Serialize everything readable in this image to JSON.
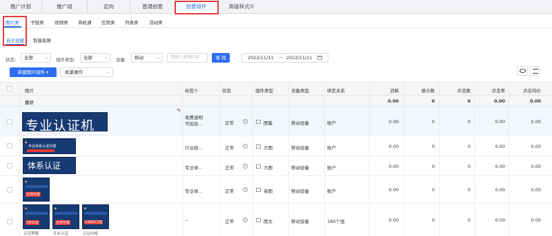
{
  "top_tabs": [
    "推广计划",
    "推广组",
    "定向",
    "普通创意",
    "创意组件",
    "高级样式⑦"
  ],
  "sub_tabs": [
    "图片类",
    "子链类",
    "视频类",
    "商机通",
    "应用类",
    "列表类",
    "活动类"
  ],
  "mode_tabs": [
    "自主创建",
    "智能拓展"
  ],
  "filters": {
    "status_label": "状态:",
    "status_value": "全部",
    "type_label": "组件类型:",
    "type_value": "全部",
    "device_label": "设备:",
    "device_value": "移动",
    "search_placeholder": "请输入查询内容",
    "search_button": "查 找",
    "date_start": "2022/11/11",
    "date_arrow": "→",
    "date_end": "2022/11/11"
  },
  "actions": {
    "new_button": "新建图片组件 ▾",
    "batch_select": "批量操作"
  },
  "table": {
    "headers": [
      "图片",
      "标签⑦",
      "状态",
      "组件类型",
      "设备类型",
      "绑定关系",
      "消耗",
      "展示数",
      "点击数",
      "点击率",
      "点击均价"
    ],
    "total_label": "总计",
    "total_values": [
      "0.00",
      "0",
      "0",
      "0.00",
      "0.00"
    ],
    "rows": [
      {
        "thumb_text": "专业认证机构",
        "label": "收费透明\n可加急...",
        "status": "正常",
        "type": "图集",
        "device": "移动设备",
        "binding": "账户",
        "metrics": [
          "0.00",
          "0",
          "0",
          "0.00",
          "0.00"
        ]
      },
      {
        "thumb_text": "专业体系认证办理",
        "label": "行业经...",
        "status": "正常",
        "type": "大图",
        "device": "移动设备",
        "binding": "账户",
        "metrics": [
          "0.00",
          "0",
          "0",
          "0.00",
          "0.00"
        ]
      },
      {
        "thumb_text": "体系认证",
        "label": "专业体...",
        "status": "正常",
        "type": "大图",
        "device": "移动设备",
        "binding": "账户",
        "metrics": [
          "0.00",
          "0",
          "0",
          "0.00",
          "0.00"
        ]
      },
      {
        "thumb_text": "正规可靠",
        "label": "专业体...",
        "status": "正常",
        "type": "单图",
        "device": "移动设备",
        "binding": "账户",
        "metrics": [
          "0.00",
          "0",
          "0",
          "0.00",
          "0.00"
        ]
      },
      {
        "thumb_texts": [
          "2天出证",
          "正规可靠",
          "价格低2万起"
        ],
        "label": "--",
        "status": "正常",
        "type": "图文",
        "device": "移动设备",
        "binding": "180个组",
        "metrics": [
          "0.00",
          "0",
          "0",
          "0.00",
          "0.00"
        ],
        "captions": [
          "认证策略",
          "专业认证",
          "认证价格"
        ]
      }
    ]
  },
  "colors": {
    "accent": "#1e6fe0",
    "button_blue": "#2d6ff0",
    "highlight_red": "#e4393c",
    "thumb_bg": "#163a72"
  }
}
